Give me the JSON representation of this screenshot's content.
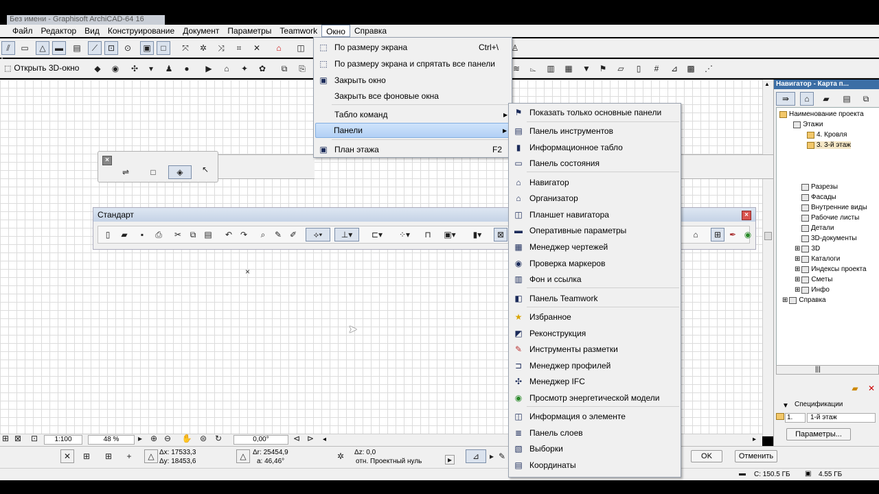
{
  "window": {
    "title": "Без имени - Graphisoft ArchiCAD-64 16"
  },
  "menubar": {
    "items": [
      {
        "label": "Файл"
      },
      {
        "label": "Редактор"
      },
      {
        "label": "Вид"
      },
      {
        "label": "Конструирование"
      },
      {
        "label": "Документ"
      },
      {
        "label": "Параметры"
      },
      {
        "label": "Teamwork"
      },
      {
        "label": "Окно"
      },
      {
        "label": "Справка"
      }
    ],
    "active": "Окно"
  },
  "toolbar2": {
    "open_3d": "Открыть 3D-окно"
  },
  "window_menu": {
    "items": [
      {
        "label": "По размеру экрана",
        "shortcut": "Ctrl+\\",
        "icon": "fit-screen-icon"
      },
      {
        "label": "По размеру экрана и спрятать все панели",
        "shortcut": "",
        "icon": "fit-hide-icon"
      },
      {
        "label": "Закрыть окно",
        "shortcut": "",
        "icon": "close-window-icon"
      },
      {
        "label": "Закрыть все фоновые окна",
        "shortcut": ""
      },
      {
        "label": "Табло команд",
        "shortcut": ""
      },
      {
        "label": "Панели",
        "shortcut": ""
      },
      {
        "label": "План этажа",
        "shortcut": "F2",
        "icon": "floor-plan-icon"
      }
    ]
  },
  "panels_submenu": {
    "items": [
      {
        "label": "Показать только основные панели",
        "icon": "flag-icon"
      },
      {
        "label": "Панель инструментов",
        "icon": "toolbox-icon"
      },
      {
        "label": "Информационное табло",
        "icon": "info-box-icon"
      },
      {
        "label": "Панель состояния",
        "icon": "status-bar-icon"
      },
      {
        "label": "Навигатор",
        "icon": "navigator-icon"
      },
      {
        "label": "Организатор",
        "icon": "organizer-icon"
      },
      {
        "label": "Планшет навигатора",
        "icon": "navigator-preview-icon"
      },
      {
        "label": "Оперативные параметры",
        "icon": "quick-options-icon"
      },
      {
        "label": "Менеджер чертежей",
        "icon": "drawing-manager-icon"
      },
      {
        "label": "Проверка маркеров",
        "icon": "marker-check-icon"
      },
      {
        "label": "Фон и ссылка",
        "icon": "trace-reference-icon"
      },
      {
        "label": "Панель Teamwork",
        "icon": "teamwork-icon"
      },
      {
        "label": "Избранное",
        "icon": "star-icon"
      },
      {
        "label": "Реконструкция",
        "icon": "renovation-icon"
      },
      {
        "label": "Инструменты разметки",
        "icon": "markup-icon"
      },
      {
        "label": "Менеджер профилей",
        "icon": "profile-manager-icon"
      },
      {
        "label": "Менеджер IFC",
        "icon": "ifc-icon"
      },
      {
        "label": "Просмотр энергетической модели",
        "icon": "energy-icon"
      },
      {
        "label": "Информация о элементе",
        "icon": "element-info-icon"
      },
      {
        "label": "Панель слоев",
        "icon": "layers-icon"
      },
      {
        "label": "Выборки",
        "icon": "selections-icon"
      },
      {
        "label": "Координаты",
        "icon": "coordinates-icon"
      }
    ]
  },
  "standard_toolbar": {
    "title": "Стандарт"
  },
  "navigator": {
    "title": "Навигатор - Карта п...",
    "tree": [
      {
        "label": "Наименование проекта",
        "level": 0,
        "folder": true
      },
      {
        "label": "Этажи",
        "level": 1
      },
      {
        "label": "4. Кровля",
        "level": 2,
        "folder": true
      },
      {
        "label": "3. 3-й этаж",
        "level": 2,
        "folder": true,
        "selected": true
      },
      {
        "label": "Разрезы",
        "level": 1
      },
      {
        "label": "Фасады",
        "level": 1
      },
      {
        "label": "Внутренние виды",
        "level": 1
      },
      {
        "label": "Рабочие листы",
        "level": 1
      },
      {
        "label": "Детали",
        "level": 1
      },
      {
        "label": "3D-документы",
        "level": 1
      },
      {
        "label": "3D",
        "level": 1
      },
      {
        "label": "Каталоги",
        "level": 1
      },
      {
        "label": "Индексы проекта",
        "level": 1
      },
      {
        "label": "Сметы",
        "level": 1
      },
      {
        "label": "Инфо",
        "level": 1
      },
      {
        "label": "Справка",
        "level": 0
      }
    ],
    "specs_label": "Спецификации",
    "floor_num": "1.",
    "floor_name": "1-й этаж",
    "params_button": "Параметры..."
  },
  "zoom": {
    "scale": "1:100",
    "zoom": "48 %",
    "angle": "0,00°"
  },
  "coords": {
    "dx": "Δx: 17533,3",
    "dy": "Δy: 18453,6",
    "dr": "Δr: 25454,9",
    "a": "a: 46,46°",
    "dz": "Δz: 0,0",
    "ref": "отн. Проектный нуль"
  },
  "dialog_buttons": {
    "ok": "OK",
    "cancel": "Отменить"
  },
  "disk": {
    "c": "C: 150.5 ГБ",
    "mem": "4.55 ГБ"
  }
}
